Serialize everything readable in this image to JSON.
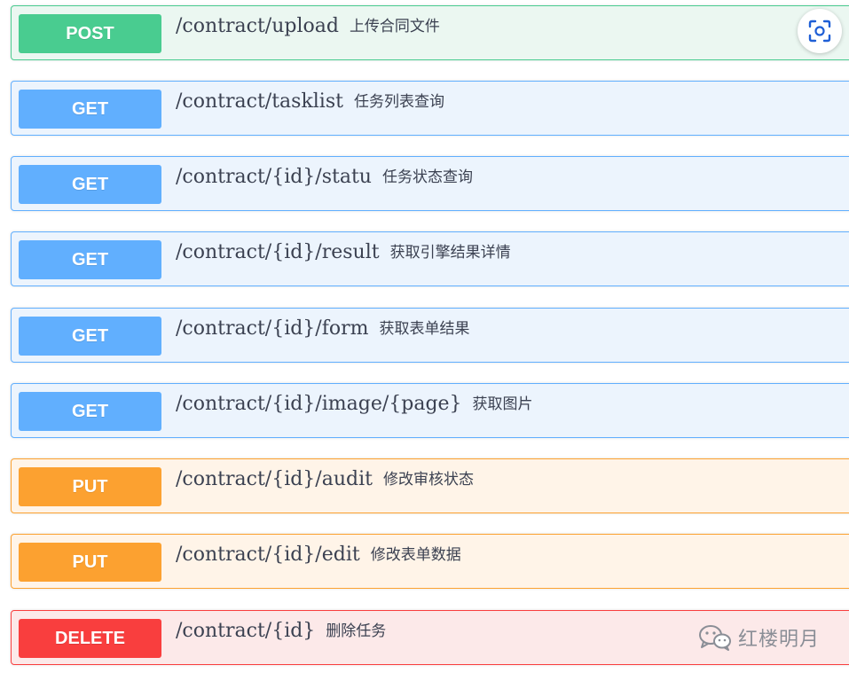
{
  "operations": [
    {
      "method": "POST",
      "path": "/contract/upload",
      "summary": "上传合同文件"
    },
    {
      "method": "GET",
      "path": "/contract/tasklist",
      "summary": "任务列表查询"
    },
    {
      "method": "GET",
      "path": "/contract/{id}/statu",
      "summary": "任务状态查询"
    },
    {
      "method": "GET",
      "path": "/contract/{id}/result",
      "summary": "获取引擎结果详情"
    },
    {
      "method": "GET",
      "path": "/contract/{id}/form",
      "summary": "获取表单结果"
    },
    {
      "method": "GET",
      "path": "/contract/{id}/image/{page}",
      "summary": "获取图片"
    },
    {
      "method": "PUT",
      "path": "/contract/{id}/audit",
      "summary": "修改审核状态"
    },
    {
      "method": "PUT",
      "path": "/contract/{id}/edit",
      "summary": "修改表单数据"
    },
    {
      "method": "DELETE",
      "path": "/contract/{id}",
      "summary": "删除任务"
    }
  ],
  "method_colors": {
    "POST": "#49cc90",
    "GET": "#61affe",
    "PUT": "#fca130",
    "DELETE": "#f93e3e"
  },
  "scan_button": {
    "icon": "scan-icon"
  },
  "watermark": {
    "icon": "wechat-icon",
    "text": "红楼明月"
  }
}
